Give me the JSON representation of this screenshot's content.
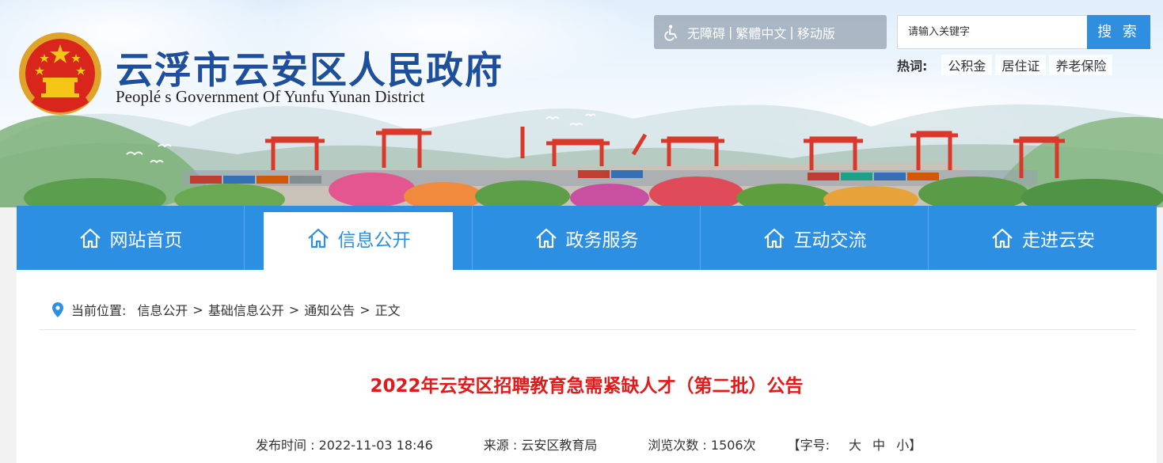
{
  "header": {
    "site_title": "云浮市云安区人民政府",
    "site_subtitle": "Peoplé s Government Of Yunfu Yunan District",
    "accessibility_bar": {
      "items": [
        "无障碍",
        "繁體中文",
        "移动版"
      ],
      "separator": "|"
    },
    "search": {
      "placeholder": "请输入关键字",
      "button_label": "搜 索"
    },
    "hotwords": {
      "label": "热词:",
      "items": [
        "公积金",
        "居住证",
        "养老保险"
      ]
    }
  },
  "nav": {
    "items": [
      {
        "label": "网站首页",
        "icon": "home-icon",
        "active": false
      },
      {
        "label": "信息公开",
        "icon": "home-icon",
        "active": true
      },
      {
        "label": "政务服务",
        "icon": "home-icon",
        "active": false
      },
      {
        "label": "互动交流",
        "icon": "home-icon",
        "active": false
      },
      {
        "label": "走进云安",
        "icon": "home-icon",
        "active": false
      }
    ]
  },
  "breadcrumb": {
    "label": "当前位置:",
    "items": [
      "信息公开",
      "基础信息公开",
      "通知公告",
      "正文"
    ],
    "separator": ">"
  },
  "article": {
    "title": "2022年云安区招聘教育急需紧缺人才（第二批）公告",
    "publish_time": "发布时间 : 2022-11-03 18:46",
    "source": "来源 : 云安区教育局",
    "views": "浏览次数 : 1506次",
    "font_size": {
      "label": "【字号:",
      "options": [
        "大",
        "中",
        "小"
      ],
      "close": "】"
    }
  },
  "colors": {
    "brand_blue": "#2d8fe2",
    "title_red": "#e21a1a",
    "site_title_blue": "#1d4f9c"
  }
}
